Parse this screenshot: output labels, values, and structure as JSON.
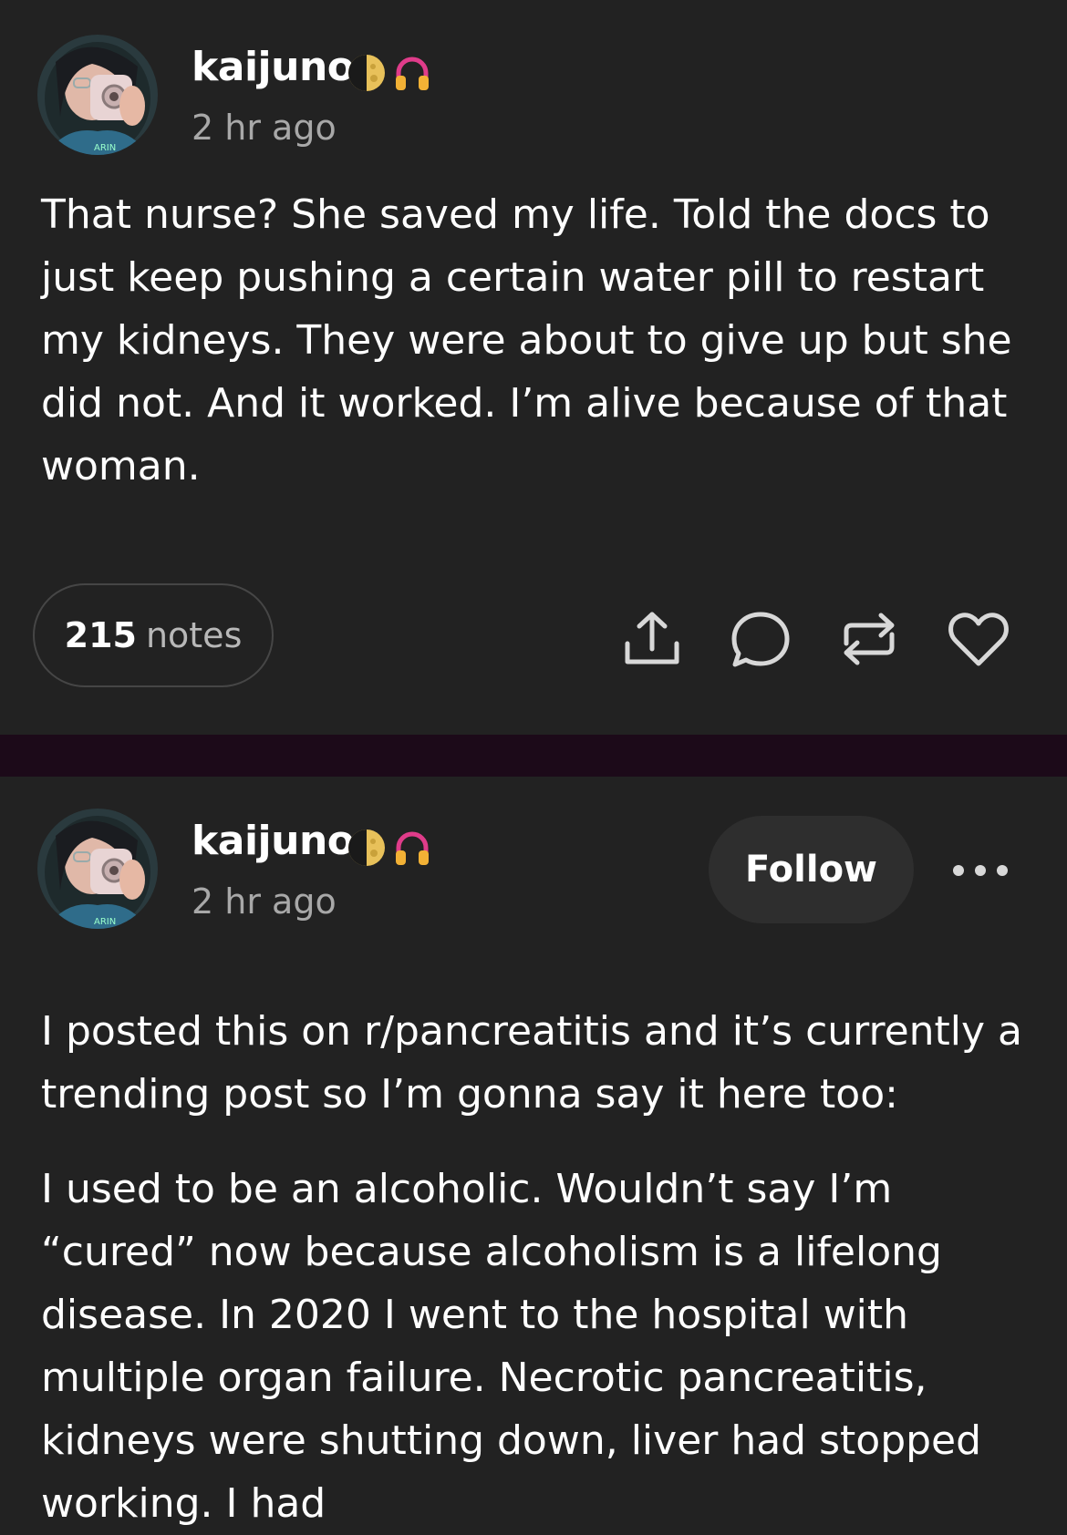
{
  "colors": {
    "background": "#222222",
    "divider": "#1c0a19",
    "text_primary": "#ffffff",
    "text_secondary": "#a8a8a8",
    "follow_button_bg": "#2e2e2e"
  },
  "posts": [
    {
      "username": "kaijuno",
      "badges": [
        "moon-phase-icon",
        "headphones-icon"
      ],
      "timestamp": "2 hr ago",
      "body": [
        "That nurse? She saved my life. Told the docs to just keep pushing a certain water pill to restart my kidneys. They were about to give up but she did not. And it worked. I’m alive because of that woman."
      ],
      "notes_count": "215",
      "notes_label": "notes",
      "actions": [
        "share-icon",
        "comment-icon",
        "reblog-icon",
        "like-icon"
      ]
    },
    {
      "username": "kaijuno",
      "badges": [
        "moon-phase-icon",
        "headphones-icon"
      ],
      "timestamp": "2 hr ago",
      "follow_label": "Follow",
      "more_icon": "more-options-icon",
      "body": [
        "I posted this on r/pancreatitis and it’s currently a trending post so I’m gonna say it here too:",
        "I used to be an alcoholic. Wouldn’t say I’m “cured” now because alcoholism is a lifelong disease. In 2020 I went to the hospital with multiple organ failure. Necrotic pancreatitis, kidneys were shutting down, liver had stopped working. I had"
      ]
    }
  ]
}
